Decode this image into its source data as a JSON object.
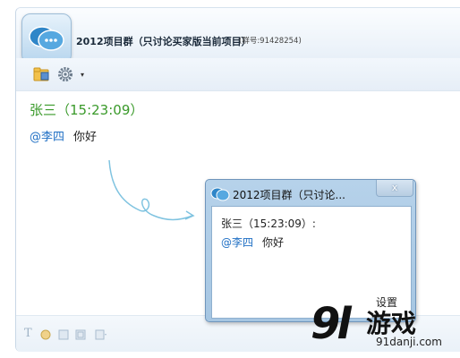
{
  "window": {
    "title": "2012项目群（只讨论买家版当前项目）",
    "group_number": "(群号:91428254)"
  },
  "toolbar": {
    "icons": [
      "folder-icon",
      "gear-icon",
      "dropdown-arrow-icon"
    ],
    "dropdown_glyph": "▾"
  },
  "message": {
    "sender": "张三（15:23:09）",
    "mention": "@李四",
    "text": "你好"
  },
  "popup": {
    "title": "2012项目群（只讨论...",
    "close_glyph": "x",
    "sender": "张三（15:23:09）:",
    "mention": "@李四",
    "text": "你好",
    "settings_label": "设置"
  },
  "bottom_toolbar": {
    "icons": [
      "font-icon",
      "emoji-icon",
      "image-icon",
      "screenshot-icon",
      "message-history-icon"
    ],
    "font_glyph": "T"
  },
  "watermark": {
    "logo": "9l",
    "name": "游戏",
    "url": "91danji.com"
  },
  "colors": {
    "sender_name": "#3a9a2a",
    "mention": "#1f6fc4",
    "popup_frame": "#a6c6e2",
    "arrow": "#7fc3e0"
  }
}
